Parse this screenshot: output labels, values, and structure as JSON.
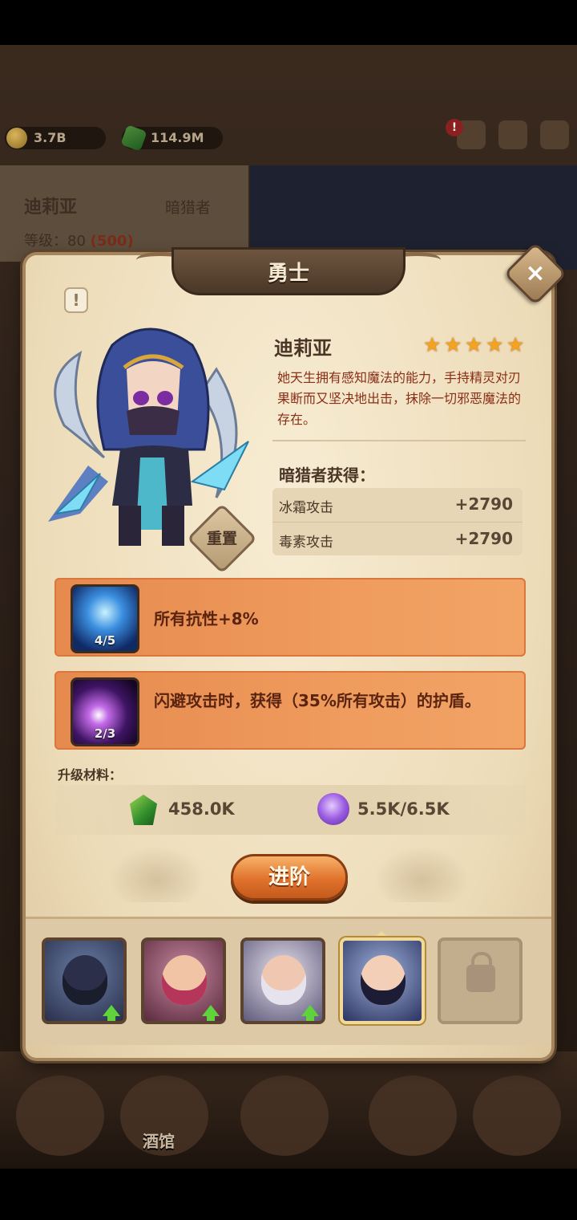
{
  "topbar": {
    "gold": "3.7B",
    "gems": "114.9M",
    "alert_mark": "!"
  },
  "background": {
    "hero_name": "迪莉亚",
    "hero_class": "暗猎者",
    "level_label": "等级：",
    "level": "80",
    "level_max": "(500)",
    "nav_label": "酒馆"
  },
  "panel": {
    "title": "勇士",
    "close_symbol": "×",
    "info_symbol": "!",
    "hero_name": "迪莉亚",
    "stars": 5,
    "description": "她天生拥有感知魔法的能力，手持精灵对刃果断而又坚决地出击，抹除一切邪恶魔法的存在。",
    "reset_label": "重置",
    "gain_title": "暗猎者获得：",
    "gains": [
      {
        "stat": "冰霜攻击",
        "value": "+2790"
      },
      {
        "stat": "毒素攻击",
        "value": "+2790"
      }
    ]
  },
  "skills": [
    {
      "level": "4/5",
      "text": "所有抗性+8%",
      "icon": "lightning-figure-icon"
    },
    {
      "level": "2/3",
      "text": "闪避攻击时，获得（35%所有攻击）的护盾。",
      "icon": "purple-meteor-icon"
    }
  ],
  "materials": {
    "label": "升级材料：",
    "green": "458.0K",
    "purple": "5.5K/6.5K"
  },
  "advance_label": "进阶",
  "colors": {
    "panel": "#f1e3c4",
    "skill_bar": "#ef9b5d",
    "desc_text": "#8a2e16",
    "advance": "#e0722c"
  }
}
